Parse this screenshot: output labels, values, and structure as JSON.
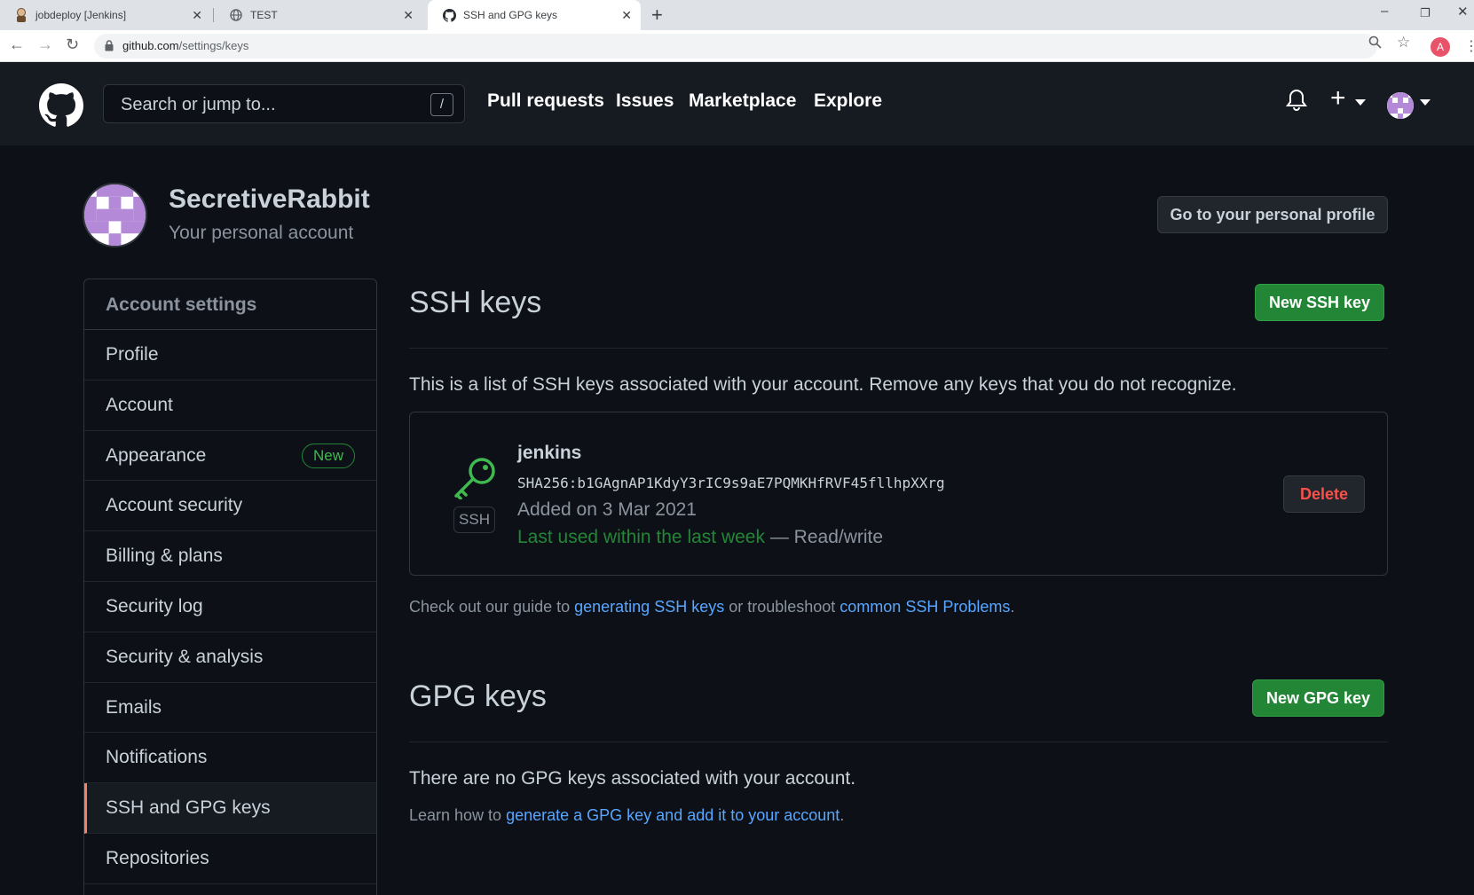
{
  "browser": {
    "tabs": [
      {
        "title": "jobdeploy [Jenkins]"
      },
      {
        "title": "TEST"
      },
      {
        "title": "SSH and GPG keys"
      }
    ],
    "url_host": "github.com",
    "url_path": "/settings/keys",
    "profile_initial": "A"
  },
  "header": {
    "search_placeholder": "Search or jump to...",
    "search_shortcut": "/",
    "nav": [
      "Pull requests",
      "Issues",
      "Marketplace",
      "Explore"
    ]
  },
  "account": {
    "name": "SecretiveRabbit",
    "subtitle": "Your personal account",
    "profile_button": "Go to your personal profile"
  },
  "sidebar": {
    "heading": "Account settings",
    "items": [
      {
        "label": "Profile"
      },
      {
        "label": "Account"
      },
      {
        "label": "Appearance",
        "badge": "New"
      },
      {
        "label": "Account security"
      },
      {
        "label": "Billing & plans"
      },
      {
        "label": "Security log"
      },
      {
        "label": "Security & analysis"
      },
      {
        "label": "Emails"
      },
      {
        "label": "Notifications"
      },
      {
        "label": "SSH and GPG keys",
        "selected": true
      },
      {
        "label": "Repositories"
      }
    ]
  },
  "ssh": {
    "title": "SSH keys",
    "new_button": "New SSH key",
    "description": "This is a list of SSH keys associated with your account. Remove any keys that you do not recognize.",
    "key": {
      "type_label": "SSH",
      "name": "jenkins",
      "fingerprint": "SHA256:b1GAgnAP1KdyY3rIC9s9aE7PQMKHfRVF45fllhpXXrg",
      "added": "Added on 3 Mar 2021",
      "last_used": "Last used within the last week",
      "access": " — Read/write",
      "delete_button": "Delete"
    },
    "guide_prefix": "Check out our guide to ",
    "guide_link1": "generating SSH keys",
    "guide_middle": " or troubleshoot ",
    "guide_link2": "common SSH Problems",
    "guide_suffix": "."
  },
  "gpg": {
    "title": "GPG keys",
    "new_button": "New GPG key",
    "empty": "There are no GPG keys associated with your account.",
    "learn_prefix": "Learn how to ",
    "learn_link": "generate a GPG key and add it to your account",
    "learn_suffix": "."
  },
  "colors": {
    "background": "#0d1117",
    "header": "#161b22",
    "green_button": "#238636",
    "link": "#58a6ff",
    "danger": "#f85149",
    "selected_accent": "#f78166"
  }
}
